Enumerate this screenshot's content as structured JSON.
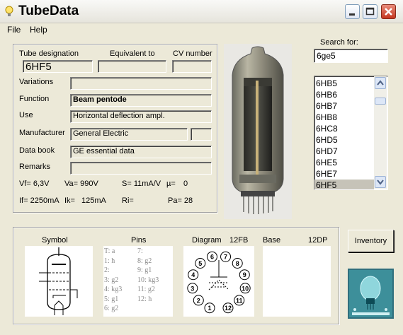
{
  "window": {
    "title": "TubeData"
  },
  "menu": {
    "file": "File",
    "help": "Help"
  },
  "fields": {
    "tube_designation_label": "Tube designation",
    "equivalent_label": "Equivalent to",
    "cv_label": "CV number",
    "tube_designation_value": "6HF5",
    "variations_label": "Variations",
    "function_label": "Function",
    "function_value": "Beam pentode",
    "use_label": "Use",
    "use_value": "Horizontal deflection ampl.",
    "manufacturer_label": "Manufacturer",
    "manufacturer_value": "General Electric",
    "databook_label": "Data book",
    "databook_value": "GE essential data",
    "remarks_label": "Remarks"
  },
  "specs": {
    "vf": "Vf= 6,3V",
    "va": "Va= 990V",
    "s": "S= 11mA/V",
    "mu": "µ=",
    "mu_val": "0",
    "if": "If= 2250mA",
    "ik": "Ik=",
    "ik_val": "125mA",
    "ri": "Ri=",
    "pa": "Pa= 28"
  },
  "search": {
    "label": "Search for:",
    "value": "6ge5"
  },
  "list": {
    "items": [
      "6HB5",
      "6HB6",
      "6HB7",
      "6HB8",
      "6HC8",
      "6HD5",
      "6HD7",
      "6HE5",
      "6HE7",
      "6HF5"
    ],
    "selected": "6HF5"
  },
  "bottom": {
    "symbol_label": "Symbol",
    "pins_label": "Pins",
    "diagram_label": "Diagram",
    "diagram_code": "12FB",
    "base_label": "Base",
    "base_code": "12DP",
    "pins_col1": [
      "T: a",
      "1: h",
      "2:",
      "3: g2",
      "4: kg3",
      "5: g1",
      "6: g2"
    ],
    "pins_col2": [
      "7:",
      "8: g2",
      "9: g1",
      "10: kg3",
      "11: g2",
      "12: h"
    ],
    "diagram_pins": [
      "1",
      "2",
      "3",
      "4",
      "5",
      "6",
      "7",
      "8",
      "9",
      "10",
      "11",
      "12"
    ]
  },
  "inventory_button": "Inventory"
}
